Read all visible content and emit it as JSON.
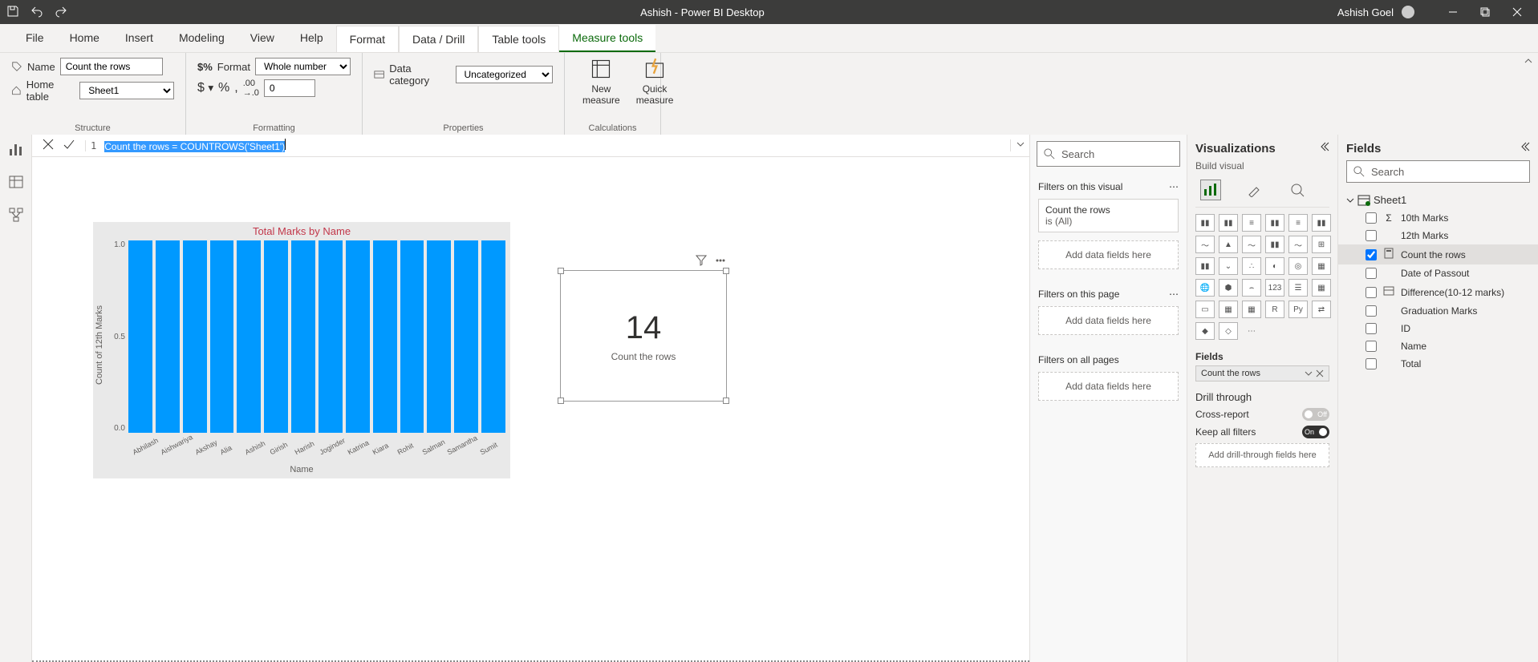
{
  "titlebar": {
    "title": "Ashish - Power BI Desktop",
    "user": "Ashish Goel"
  },
  "ribbon_tabs": [
    "File",
    "Home",
    "Insert",
    "Modeling",
    "View",
    "Help",
    "Format",
    "Data / Drill",
    "Table tools",
    "Measure tools"
  ],
  "ribbon": {
    "structure": {
      "name_label": "Name",
      "name_value": "Count the rows",
      "home_table_label": "Home table",
      "home_table_value": "Sheet1",
      "group": "Structure"
    },
    "formatting": {
      "format_label": "Format",
      "format_value": "Whole number",
      "step_value": "0",
      "group": "Formatting"
    },
    "properties": {
      "data_cat_label": "Data category",
      "data_cat_value": "Uncategorized",
      "group": "Properties"
    },
    "calculations": {
      "new_measure": "New measure",
      "quick_measure": "Quick measure",
      "group": "Calculations"
    }
  },
  "formula": {
    "line": "1",
    "display_selected": "Count the rows = COUNTROWS('Sheet1')",
    "measure_name": "Count the rows",
    "equals": " = ",
    "func": "COUNTROWS",
    "arg": "('Sheet1')"
  },
  "chart_data": {
    "type": "bar",
    "title": "Total Marks by Name",
    "ylabel": "Count of 12th Marks",
    "xlabel": "Name",
    "ylim": [
      0.0,
      1.0
    ],
    "yticks": [
      "1.0",
      "0.5",
      "0.0"
    ],
    "categories": [
      "Abhilash",
      "Aishwariya",
      "Akshay",
      "Alia",
      "Ashish",
      "Girish",
      "Harish",
      "Joginder",
      "Katrina",
      "Kiara",
      "Rohit",
      "Salman",
      "Samantha",
      "Sumit"
    ],
    "values": [
      1,
      1,
      1,
      1,
      1,
      1,
      1,
      1,
      1,
      1,
      1,
      1,
      1,
      1
    ]
  },
  "card": {
    "value": "14",
    "caption": "Count the rows"
  },
  "filters": {
    "search_placeholder": "Search",
    "visual_title": "Filters on this visual",
    "visual_card_name": "Count the rows",
    "visual_card_status": "is (All)",
    "add_fields": "Add data fields here",
    "page_title": "Filters on this page",
    "all_title": "Filters on all pages"
  },
  "viz": {
    "title": "Visualizations",
    "sub": "Build visual",
    "fields_label": "Fields",
    "well_item": "Count the rows",
    "drill_title": "Drill through",
    "cross_report": "Cross-report",
    "cross_report_state": "Off",
    "keep_filters": "Keep all filters",
    "keep_filters_state": "On",
    "drill_drop": "Add drill-through fields here"
  },
  "fields": {
    "title": "Fields",
    "search_placeholder": "Search",
    "table": "Sheet1",
    "items": [
      {
        "name": "10th Marks",
        "checked": false,
        "icon": "sigma"
      },
      {
        "name": "12th Marks",
        "checked": false,
        "icon": ""
      },
      {
        "name": "Count the rows",
        "checked": true,
        "icon": "calc"
      },
      {
        "name": "Date of Passout",
        "checked": false,
        "icon": ""
      },
      {
        "name": "Difference(10-12 marks)",
        "checked": false,
        "icon": "measure"
      },
      {
        "name": "Graduation Marks",
        "checked": false,
        "icon": ""
      },
      {
        "name": "ID",
        "checked": false,
        "icon": ""
      },
      {
        "name": "Name",
        "checked": false,
        "icon": ""
      },
      {
        "name": "Total",
        "checked": false,
        "icon": ""
      }
    ]
  }
}
